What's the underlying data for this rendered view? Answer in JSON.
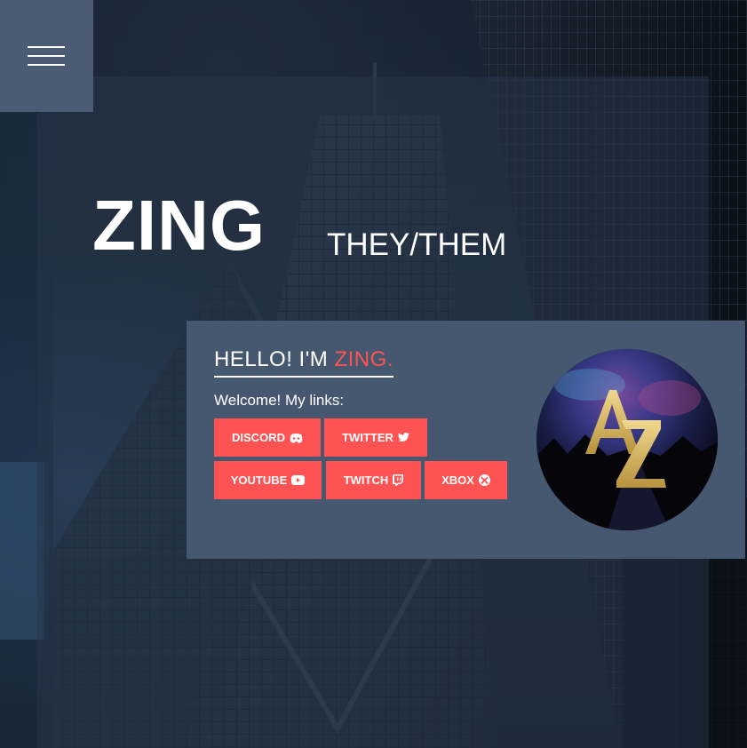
{
  "header": {
    "menu_icon": "hamburger-menu-icon"
  },
  "hero": {
    "name": "ZING",
    "pronouns": "THEY/THEM"
  },
  "card": {
    "greeting_prefix": "HELLO! I'M ",
    "greeting_name": "ZING.",
    "welcome_text": "Welcome! My links:",
    "avatar_monogram": "AZ",
    "links": [
      {
        "label": "DISCORD",
        "icon": "discord-icon"
      },
      {
        "label": "TWITTER",
        "icon": "twitter-icon"
      },
      {
        "label": "YOUTUBE",
        "icon": "youtube-icon"
      },
      {
        "label": "TWITCH",
        "icon": "twitch-icon"
      },
      {
        "label": "XBOX",
        "icon": "xbox-icon"
      }
    ]
  },
  "colors": {
    "accent": "#ff5252",
    "card_bg": "#46586f",
    "menu_bg": "#4a5b73"
  }
}
